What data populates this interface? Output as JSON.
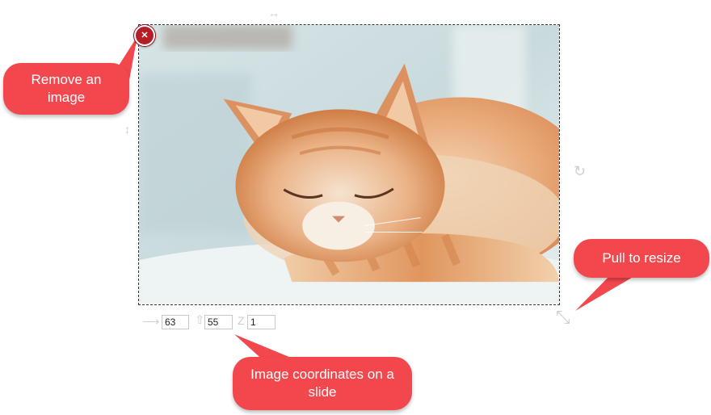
{
  "image": {
    "alt": "Sleeping ginger cat",
    "remove_glyph": "✕"
  },
  "handles": {
    "top_move": "↔",
    "left_move": "↕",
    "rotate": "↻",
    "resize": "⤡"
  },
  "coordinates": {
    "x_arrow": "⟶",
    "y_arrow": "⇧",
    "z_label": "Z",
    "x_value": "63",
    "y_value": "55",
    "z_value": "1"
  },
  "callouts": {
    "remove": "Remove an image",
    "resize": "Pull to resize",
    "coords": "Image coordinates on a slide"
  },
  "colors": {
    "callout": "#f2474d",
    "remove_button": "#b51d27"
  }
}
